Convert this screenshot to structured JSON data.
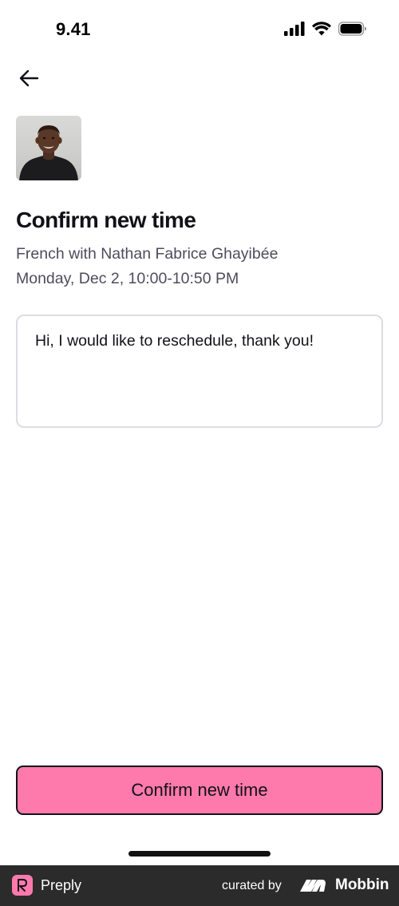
{
  "status_bar": {
    "time": "9.41",
    "icons": [
      "signal-icon",
      "wifi-icon",
      "battery-icon"
    ]
  },
  "header": {
    "back_icon": "arrow-left-icon"
  },
  "tutor": {
    "avatar": "tutor-photo"
  },
  "content": {
    "title": "Confirm new time",
    "subject": "French with Nathan Fabrice Ghayibée",
    "datetime": "Monday, Dec 2, 10:00-10:50 PM",
    "message": "Hi, I would like to reschedule, thank you!"
  },
  "actions": {
    "confirm_label": "Confirm new time",
    "confirm_color": "#ff7aac"
  },
  "footer": {
    "app_name": "Preply",
    "curated_by": "curated by",
    "brand": "Mobbin",
    "bar_color": "#2b2b2b"
  }
}
